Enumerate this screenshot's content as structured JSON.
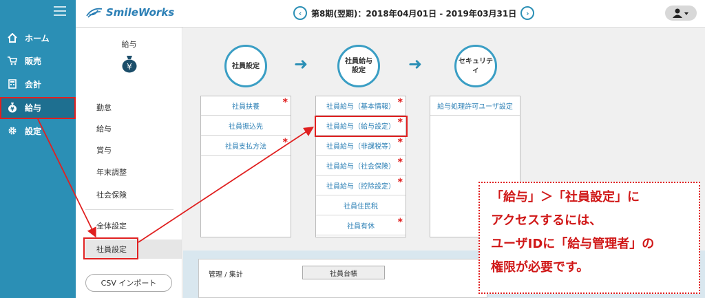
{
  "nav": {
    "items": [
      {
        "label": "ホーム",
        "icon": "home-icon"
      },
      {
        "label": "販売",
        "icon": "cart-icon"
      },
      {
        "label": "会計",
        "icon": "calculator-icon"
      },
      {
        "label": "給与",
        "icon": "moneybag-icon"
      },
      {
        "label": "設定",
        "icon": "gear-icon"
      }
    ]
  },
  "header": {
    "logo": "SmileWorks",
    "period": "第8期(翌期)：2018年04月01日 - 2019年03月31日",
    "prev": "‹",
    "next": "›"
  },
  "sidebar": {
    "title": "給与",
    "items": [
      "勤怠",
      "給与",
      "賞与",
      "年末調整",
      "社会保険"
    ],
    "items2": [
      "全体設定",
      "社員設定"
    ],
    "csv_button": "CSV インポート"
  },
  "steps": [
    {
      "label": "社員設定"
    },
    {
      "label": "社員給与設定"
    },
    {
      "label": "セキュリティ"
    }
  ],
  "panel1": [
    "社員扶養",
    "社員振込先",
    "社員支払方法"
  ],
  "panel2": [
    "社員給与（基本情報）",
    "社員給与（給与設定）",
    "社員給与（非課税等）",
    "社員給与（社会保険）",
    "社員給与（控除設定）",
    "社員住民税",
    "社員有休"
  ],
  "panel3": [
    "給与処理許可ユーザ設定"
  ],
  "bottom": {
    "label": "管理 / 集計",
    "button": "社員台帳"
  },
  "callout": {
    "line1": "「給与」＞「社員設定」に",
    "line2": "アクセスするには、",
    "line3": "ユーザIDに「給与管理者」の",
    "line4": "権限が必要です。"
  },
  "colors": {
    "accent": "#2b8fb5",
    "highlight": "#e02020"
  }
}
